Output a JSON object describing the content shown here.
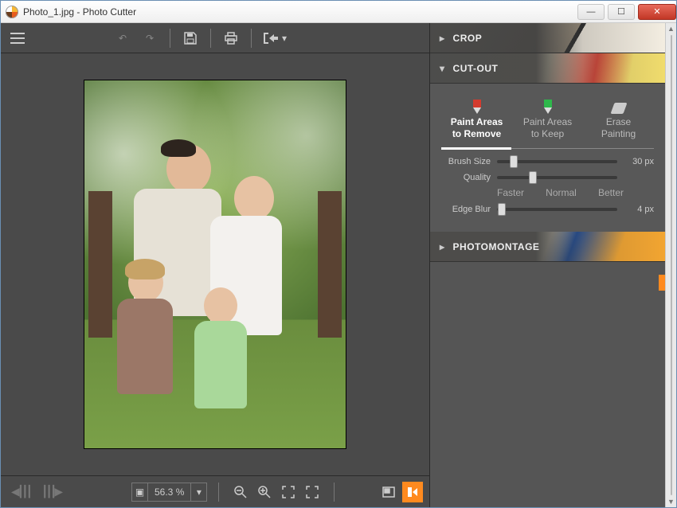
{
  "window": {
    "title": "Photo_1.jpg - Photo Cutter"
  },
  "topbar": {
    "icons": [
      "menu",
      "undo",
      "redo",
      "save",
      "print",
      "export"
    ]
  },
  "canvas": {
    "filename": "Photo_1.jpg"
  },
  "bottombar": {
    "zoom_text": "56.3 %",
    "icons": [
      "prev",
      "next",
      "fit-image",
      "zoom-out",
      "zoom-in",
      "fit-screen",
      "full-screen",
      "compare",
      "apply"
    ]
  },
  "panels": {
    "crop": {
      "label": "CROP",
      "expanded": false
    },
    "cutout": {
      "label": "CUT-OUT",
      "expanded": true,
      "tools": [
        {
          "key": "remove",
          "label_line1": "Paint Areas",
          "label_line2": "to Remove",
          "active": true
        },
        {
          "key": "keep",
          "label_line1": "Paint Areas",
          "label_line2": "to Keep",
          "active": false
        },
        {
          "key": "erase",
          "label_line1": "Erase",
          "label_line2": "Painting",
          "active": false
        }
      ],
      "sliders": {
        "brush": {
          "label": "Brush Size",
          "value_text": "30 px",
          "pos": 14
        },
        "quality": {
          "label": "Quality",
          "pos": 30,
          "ticks": [
            "Faster",
            "Normal",
            "Better"
          ]
        },
        "edge": {
          "label": "Edge Blur",
          "value_text": "4 px",
          "pos": 4
        }
      }
    },
    "photomontage": {
      "label": "PHOTOMONTAGE",
      "expanded": false
    }
  }
}
